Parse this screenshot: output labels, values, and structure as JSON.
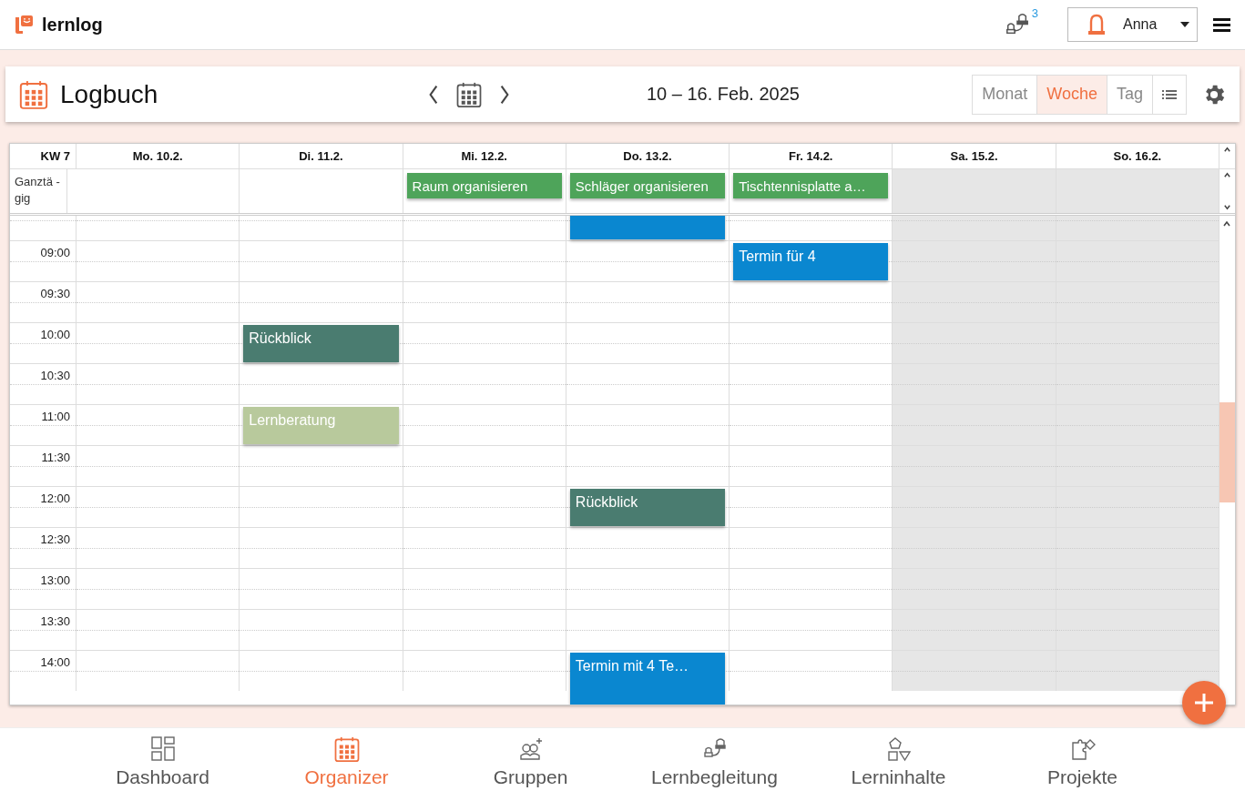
{
  "header": {
    "logo": "lernlog",
    "notification_count": "3",
    "user": "Anna"
  },
  "toolbar": {
    "title": "Logbuch",
    "date_range": "10 – 16. Feb. 2025",
    "views": [
      {
        "label": "Monat",
        "selected": false,
        "kind": "text"
      },
      {
        "label": "Woche",
        "selected": true,
        "kind": "text"
      },
      {
        "label": "Tag",
        "selected": false,
        "kind": "text"
      },
      {
        "kind": "list",
        "selected": false
      }
    ]
  },
  "calendar": {
    "week": "KW 7",
    "all_day_label": "Ganztä - gig",
    "days": [
      {
        "label": "Mo. 10.2.",
        "weekend": false
      },
      {
        "label": "Di. 11.2.",
        "weekend": false
      },
      {
        "label": "Mi. 12.2.",
        "weekend": false,
        "all_day": [
          {
            "title": "Raum organisieren",
            "color": "#4ea45a"
          }
        ]
      },
      {
        "label": "Do. 13.2.",
        "weekend": false,
        "all_day": [
          {
            "title": "Schläger organisieren",
            "color": "#4ea45a"
          }
        ]
      },
      {
        "label": "Fr. 14.2.",
        "weekend": false,
        "all_day": [
          {
            "title": "Tischtennisplatte a…",
            "color": "#4ea45a"
          }
        ]
      },
      {
        "label": "Sa. 15.2.",
        "weekend": true
      },
      {
        "label": "So. 16.2.",
        "weekend": true
      }
    ],
    "rows": [
      {
        "cells": [
          {
            "weekend": false
          },
          {
            "weekend": false
          },
          {
            "weekend": false
          },
          {
            "weekend": false,
            "event": {
              "color": "#0a87d0",
              "continues": false
            }
          },
          {
            "weekend": false
          },
          {
            "weekend": true
          },
          {
            "weekend": true
          }
        ]
      },
      {
        "time": "09:00",
        "cells": [
          {
            "weekend": false
          },
          {
            "weekend": false
          },
          {
            "weekend": false
          },
          {
            "weekend": false
          },
          {
            "weekend": false,
            "event": {
              "title": "Termin für 4",
              "color": "#0a87d0",
              "continues": false
            }
          },
          {
            "weekend": true
          },
          {
            "weekend": true
          }
        ]
      },
      {
        "time": "09:30",
        "cells": [
          {
            "weekend": false
          },
          {
            "weekend": false
          },
          {
            "weekend": false
          },
          {
            "weekend": false
          },
          {
            "weekend": false
          },
          {
            "weekend": true
          },
          {
            "weekend": true
          }
        ]
      },
      {
        "time": "10:00",
        "cells": [
          {
            "weekend": false
          },
          {
            "weekend": false,
            "event": {
              "title": "Rückblick",
              "color": "#4a7c70",
              "continues": false
            }
          },
          {
            "weekend": false
          },
          {
            "weekend": false
          },
          {
            "weekend": false
          },
          {
            "weekend": true
          },
          {
            "weekend": true
          }
        ]
      },
      {
        "time": "10:30",
        "cells": [
          {
            "weekend": false
          },
          {
            "weekend": false
          },
          {
            "weekend": false
          },
          {
            "weekend": false
          },
          {
            "weekend": false
          },
          {
            "weekend": true
          },
          {
            "weekend": true
          }
        ]
      },
      {
        "time": "11:00",
        "cells": [
          {
            "weekend": false
          },
          {
            "weekend": false,
            "event": {
              "title": "Lernberatung",
              "color": "#b8c99c",
              "continues": false
            }
          },
          {
            "weekend": false
          },
          {
            "weekend": false
          },
          {
            "weekend": false
          },
          {
            "weekend": true
          },
          {
            "weekend": true
          }
        ]
      },
      {
        "time": "11:30",
        "cells": [
          {
            "weekend": false
          },
          {
            "weekend": false
          },
          {
            "weekend": false
          },
          {
            "weekend": false
          },
          {
            "weekend": false
          },
          {
            "weekend": true
          },
          {
            "weekend": true
          }
        ]
      },
      {
        "time": "12:00",
        "cells": [
          {
            "weekend": false
          },
          {
            "weekend": false
          },
          {
            "weekend": false
          },
          {
            "weekend": false,
            "event": {
              "title": "Rückblick",
              "color": "#4a7c70",
              "continues": false
            }
          },
          {
            "weekend": false
          },
          {
            "weekend": true
          },
          {
            "weekend": true
          }
        ]
      },
      {
        "time": "12:30",
        "cells": [
          {
            "weekend": false
          },
          {
            "weekend": false
          },
          {
            "weekend": false
          },
          {
            "weekend": false
          },
          {
            "weekend": false
          },
          {
            "weekend": true
          },
          {
            "weekend": true
          }
        ]
      },
      {
        "time": "13:00",
        "cells": [
          {
            "weekend": false
          },
          {
            "weekend": false
          },
          {
            "weekend": false
          },
          {
            "weekend": false
          },
          {
            "weekend": false
          },
          {
            "weekend": true
          },
          {
            "weekend": true
          }
        ]
      },
      {
        "time": "13:30",
        "cells": [
          {
            "weekend": false
          },
          {
            "weekend": false
          },
          {
            "weekend": false
          },
          {
            "weekend": false
          },
          {
            "weekend": false
          },
          {
            "weekend": true
          },
          {
            "weekend": true
          }
        ]
      },
      {
        "time": "14:00",
        "cells": [
          {
            "weekend": false
          },
          {
            "weekend": false
          },
          {
            "weekend": false
          },
          {
            "weekend": false,
            "event": {
              "title": "Termin mit 4 Te…",
              "color": "#0a87d0",
              "continues": true
            }
          },
          {
            "weekend": false
          },
          {
            "weekend": true
          },
          {
            "weekend": true
          }
        ]
      }
    ]
  },
  "nav": [
    {
      "label": "Dashboard",
      "selected": false,
      "kind": "dashboard"
    },
    {
      "label": "Organizer",
      "selected": true,
      "kind": "calendar"
    },
    {
      "label": "Gruppen",
      "selected": false,
      "kind": "groups"
    },
    {
      "label": "Lernbegleitung",
      "selected": false,
      "kind": "mentoring"
    },
    {
      "label": "Lerninhalte",
      "selected": false,
      "kind": "shapes"
    },
    {
      "label": "Projekte",
      "selected": false,
      "kind": "puzzle"
    }
  ]
}
